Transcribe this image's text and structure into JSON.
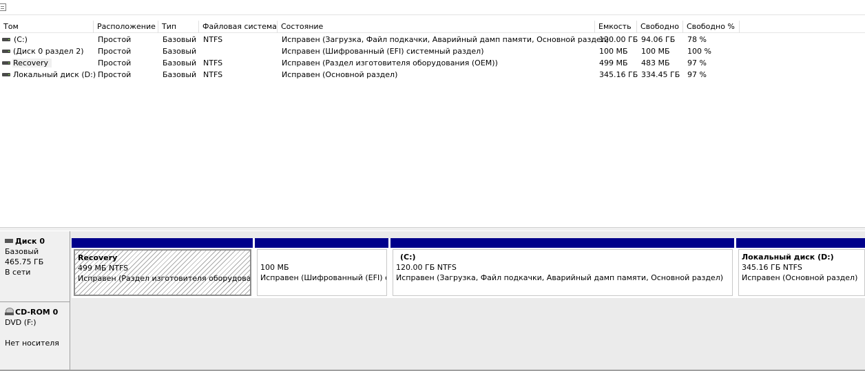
{
  "columns": [
    "Том",
    "Расположение",
    "Тип",
    "Файловая система",
    "Состояние",
    "Емкость",
    "Свободно",
    "Свободно %"
  ],
  "volumes": [
    {
      "name": "(C:)",
      "layout": "Простой",
      "type": "Базовый",
      "fs": "NTFS",
      "status": "Исправен (Загрузка, Файл подкачки, Аварийный дамп памяти, Основной раздел)",
      "capacity": "120.00 ГБ",
      "free": "94.06 ГБ",
      "free_pct": "78 %"
    },
    {
      "name": "(Диск 0 раздел 2)",
      "layout": "Простой",
      "type": "Базовый",
      "fs": "",
      "status": "Исправен (Шифрованный (EFI) системный раздел)",
      "capacity": "100 МБ",
      "free": "100 МБ",
      "free_pct": "100 %"
    },
    {
      "name": "Recovery",
      "layout": "Простой",
      "type": "Базовый",
      "fs": "NTFS",
      "status": "Исправен (Раздел изготовителя оборудования (OEM))",
      "capacity": "499 МБ",
      "free": "483 МБ",
      "free_pct": "97 %"
    },
    {
      "name": "Локальный диск (D:)",
      "layout": "Простой",
      "type": "Базовый",
      "fs": "NTFS",
      "status": "Исправен (Основной раздел)",
      "capacity": "345.16 ГБ",
      "free": "334.45 ГБ",
      "free_pct": "97 %"
    }
  ],
  "disk0": {
    "title": "Диск 0",
    "type": "Базовый",
    "size": "465.75 ГБ",
    "state": "В сети",
    "partitions": [
      {
        "title": "Recovery",
        "size": "499 МБ NTFS",
        "status": "Исправен (Раздел изготовителя оборудования (OEM))"
      },
      {
        "title": "",
        "size": "100 МБ",
        "status": "Исправен (Шифрованный (EFI) системный раздел)"
      },
      {
        "title": "(C:)",
        "size": "120.00 ГБ NTFS",
        "status": "Исправен (Загрузка, Файл подкачки, Аварийный дамп памяти, Основной раздел)"
      },
      {
        "title": "Локальный диск  (D:)",
        "size": "345.16 ГБ NTFS",
        "status": "Исправен (Основной раздел)"
      }
    ]
  },
  "cdrom0": {
    "title": "CD-ROM 0",
    "drive": "DVD (F:)",
    "state": "Нет носителя"
  },
  "colors": {
    "partition_bar": "#00008b",
    "background": "#ebebeb"
  }
}
